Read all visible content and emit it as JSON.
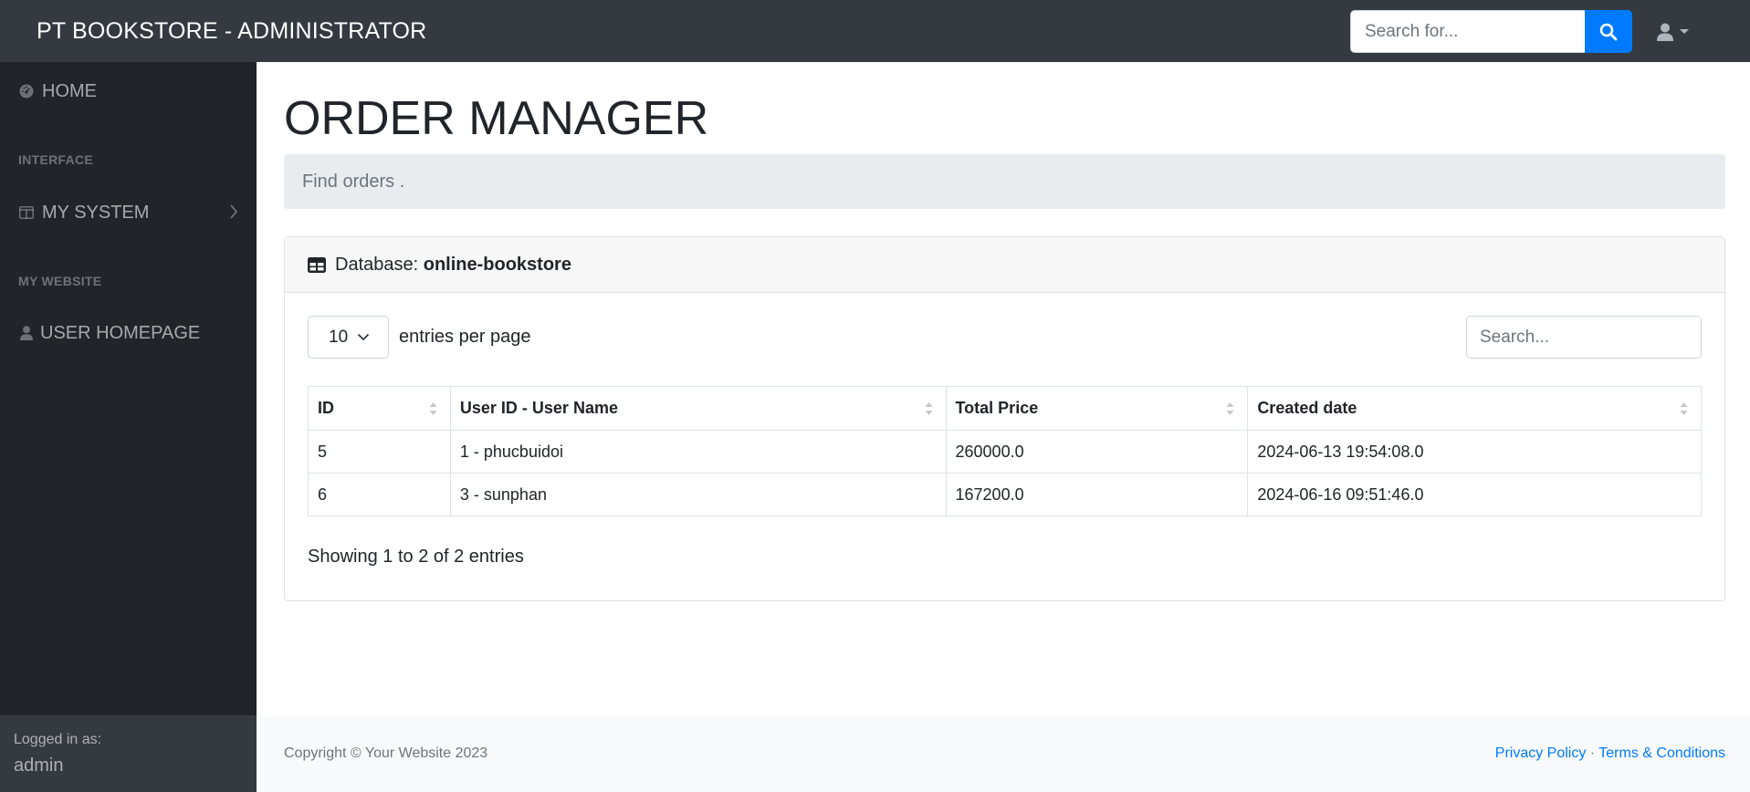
{
  "navbar": {
    "brand": "PT BOOKSTORE - ADMINISTRATOR",
    "search_placeholder": "Search for..."
  },
  "sidebar": {
    "home_label": "HOME",
    "heading_interface": "INTERFACE",
    "my_system_label": "MY SYSTEM",
    "heading_website": "MY WEBSITE",
    "user_homepage_label": "USER HOMEPAGE",
    "logged_label": "Logged in as:",
    "logged_user": "admin"
  },
  "main": {
    "title": "ORDER MANAGER",
    "breadcrumb": "Find orders ."
  },
  "card": {
    "header_prefix": "Database: ",
    "header_db": "online-bookstore",
    "per_page_value": "10",
    "per_page_label": "entries per page",
    "search_placeholder": "Search...",
    "columns": [
      "ID",
      "User ID - User Name",
      "Total Price",
      "Created date"
    ],
    "rows": [
      [
        "5",
        "1 - phucbuidoi",
        "260000.0",
        "2024-06-13 19:54:08.0"
      ],
      [
        "6",
        "3 - sunphan",
        "167200.0",
        "2024-06-16 09:51:46.0"
      ]
    ],
    "info": "Showing 1 to 2 of 2 entries"
  },
  "footer": {
    "copyright": "Copyright © Your Website 2023",
    "privacy": "Privacy Policy",
    "separator": "·",
    "terms": "Terms & Conditions"
  },
  "colors": {
    "navbar": "#343a40",
    "sidebar": "#212529",
    "accent": "#007bff"
  }
}
